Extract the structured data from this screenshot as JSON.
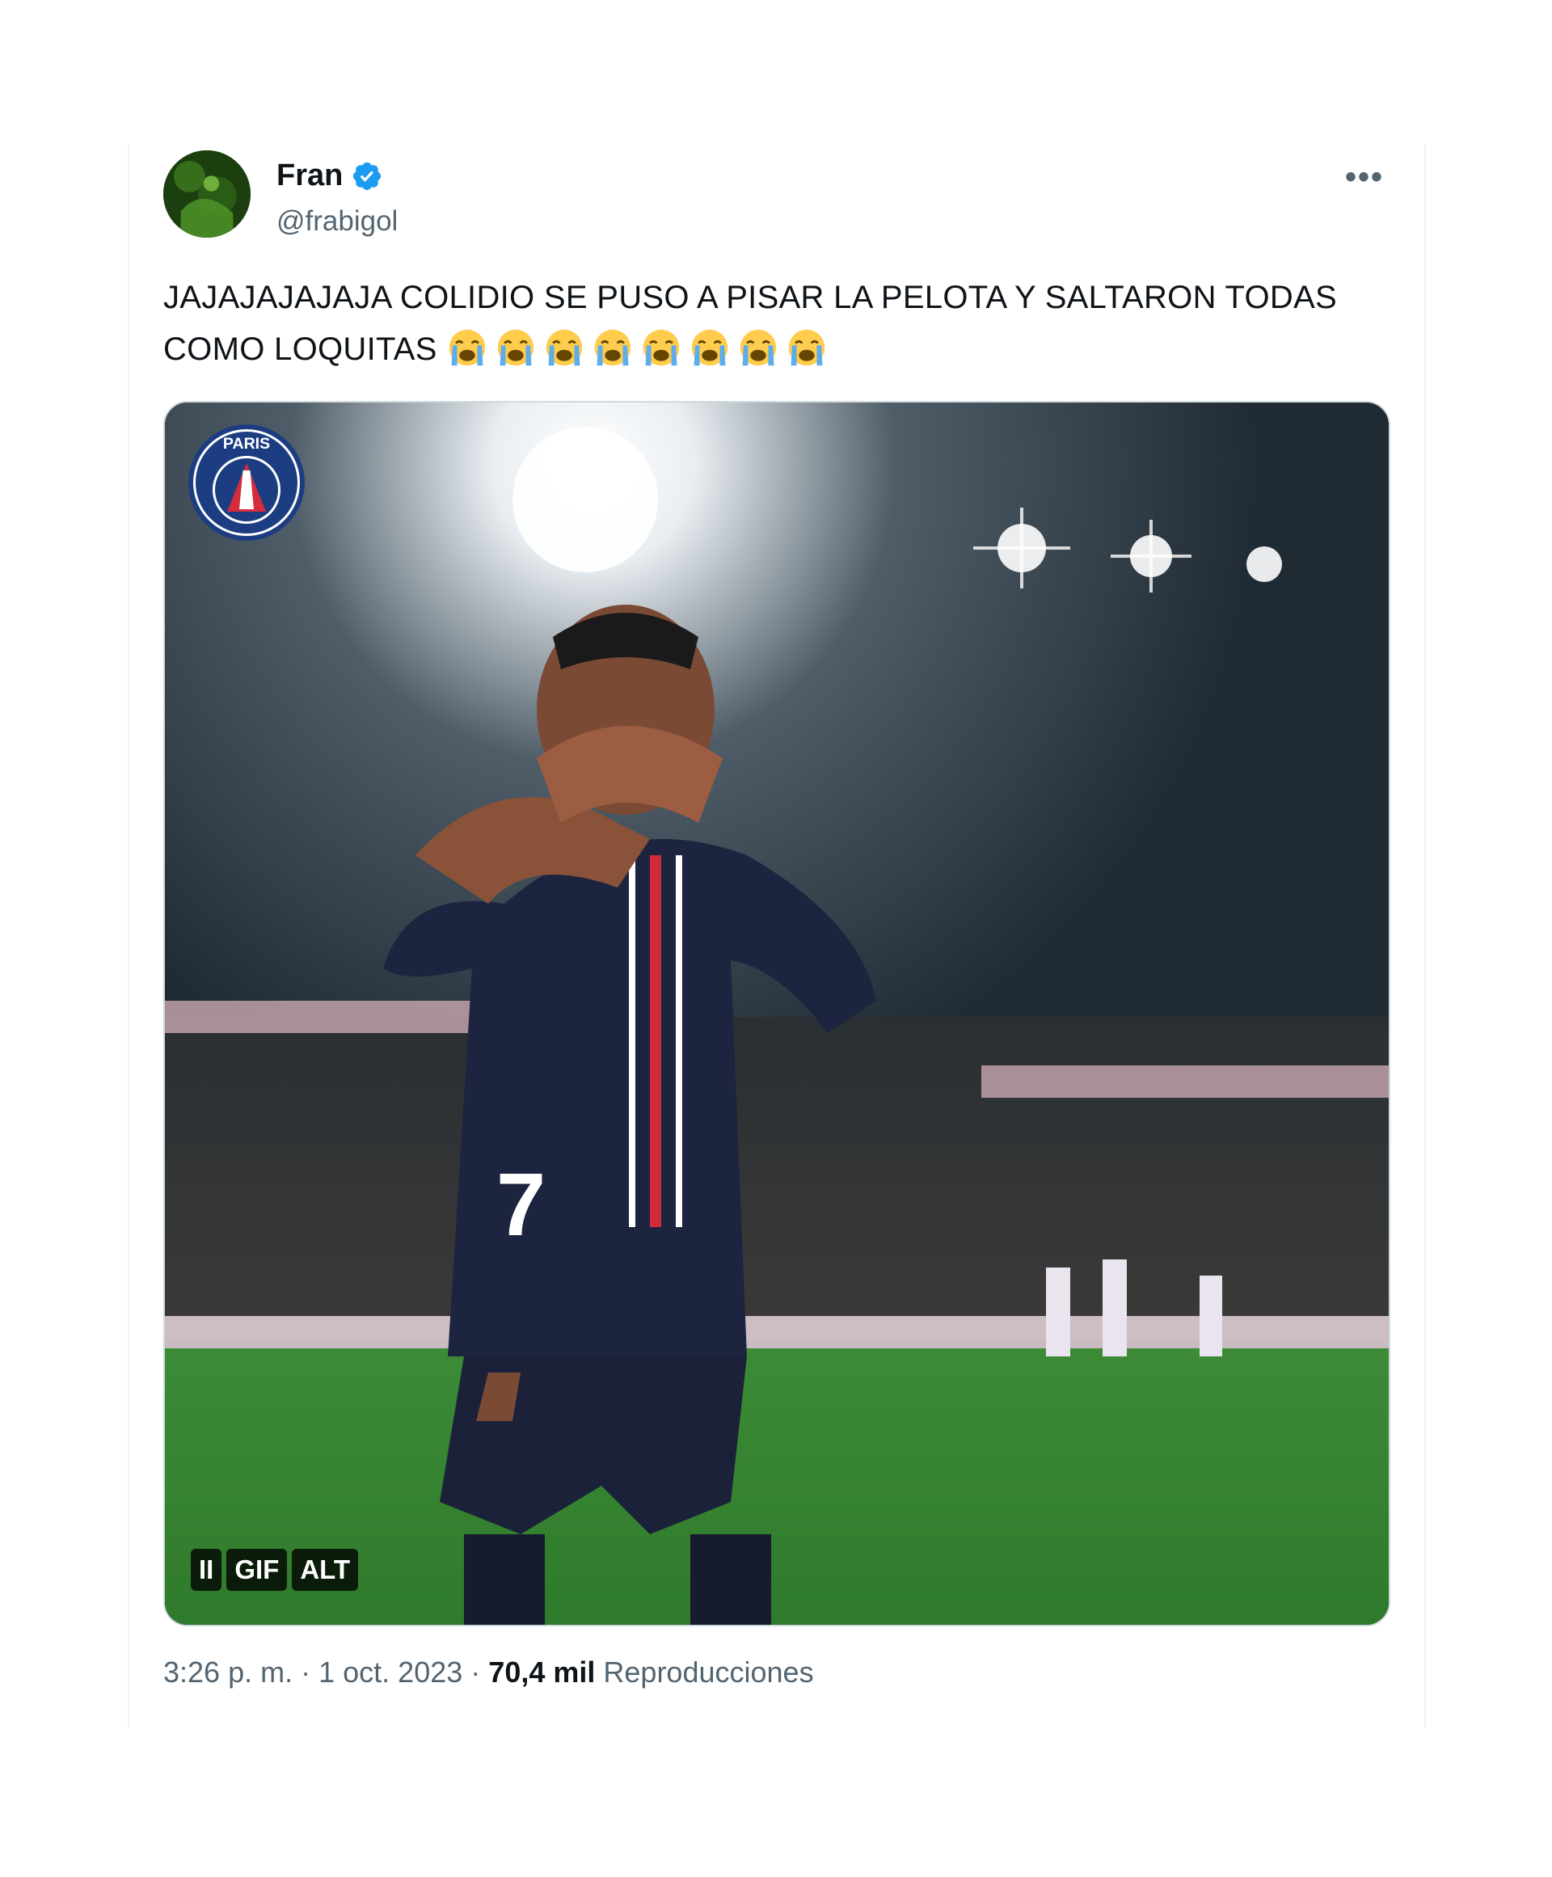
{
  "user": {
    "display_name": "Fran",
    "handle": "@frabigol",
    "verified": true,
    "avatar_icon": "avatar-image"
  },
  "more_label": "•••",
  "tweet": {
    "text": "JAJAJAJAJAJA COLIDIO SE PUSO A PISAR LA PELOTA Y SALTARON TODAS COMO LOQUITAS",
    "emoji_name": "loudly-crying-face-icon",
    "emoji_count": 8
  },
  "media": {
    "logo_text": "PARIS",
    "jersey_number": "7",
    "controls": {
      "pause_label": "II",
      "gif_label": "GIF",
      "alt_label": "ALT"
    }
  },
  "meta": {
    "time": "3:26 p. m.",
    "sep1": "·",
    "date": "1 oct. 2023",
    "sep2": "·",
    "views": "70,4 mil",
    "views_label": "Reproducciones"
  },
  "colors": {
    "verified_blue": "#1d9bf0",
    "text_primary": "#0f1419",
    "text_secondary": "#536471"
  }
}
